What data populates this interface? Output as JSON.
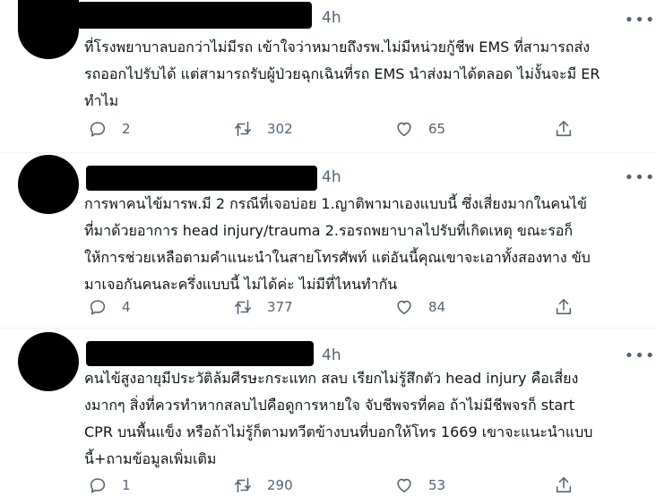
{
  "tweets": [
    {
      "time": "4h",
      "text": "ที่โรงพยาบาลบอกว่าไม่มีรถ เข้าใจว่าหมายถึงรพ.ไม่มีหน่วยกู้ชีพ EMS ที่สามารถส่ง\nรถออกไปรับได้ แต่สามารถรับผู้ป่วยฉุกเฉินที่รถ EMS นำส่งมาได้ตลอด ไม่งั้นจะมี ER\nทำไม",
      "replies": "2",
      "retweets": "302",
      "likes": "65"
    },
    {
      "time": "4h",
      "text": "การพาคนไข้มารพ.มี 2 กรณีที่เจอบ่อย 1.ญาติพามาเองแบบนี้ ซึ่งเสี่ยงมากในคนไข้\nที่มาด้วยอาการ head injury/trauma 2.รอรถพยาบาลไปรับที่เกิดเหตุ ขณะรอก็\nให้การช่วยเหลือตามคำแนะนำในสายโทรศัพท์ แต่อันนี้คุณเขาจะเอาทั้งสองทาง ขับ\nมาเจอกันคนละครึ่งแบบนี้ ไม่ได้ค่ะ ไม่มีที่ไหนทำกัน",
      "replies": "4",
      "retweets": "377",
      "likes": "84"
    },
    {
      "time": "4h",
      "text": "คนไข้สูงอายุมีประวัติล้มศีรษะกระแทก สลบ เรียกไม่รู้สึกตัว head injury คือเสี่ยง\nงมากๆ สิ่งที่ควรทำหากสลบไปคือดูการหายใจ จับชีพจรที่คอ ถ้าไม่มีชีพจรก็ start\nCPR บนพื้นแข็ง หรือถ้าไม่รู้ก็ตามทวีตข้างบนที่บอกให้โทร 1669 เขาจะแนะนำแบบ\nนี้+ถามข้อมูลเพิ่มเติม",
      "replies": "1",
      "retweets": "290",
      "likes": "53"
    }
  ],
  "icons": {
    "reply": "reply-icon",
    "retweet": "retweet-icon",
    "like": "like-icon",
    "share": "share-icon",
    "more": "more-icon"
  },
  "colors": {
    "text": "#0f1419",
    "secondary": "#536471",
    "divider": "#eff3f4",
    "redaction": "#000000"
  }
}
